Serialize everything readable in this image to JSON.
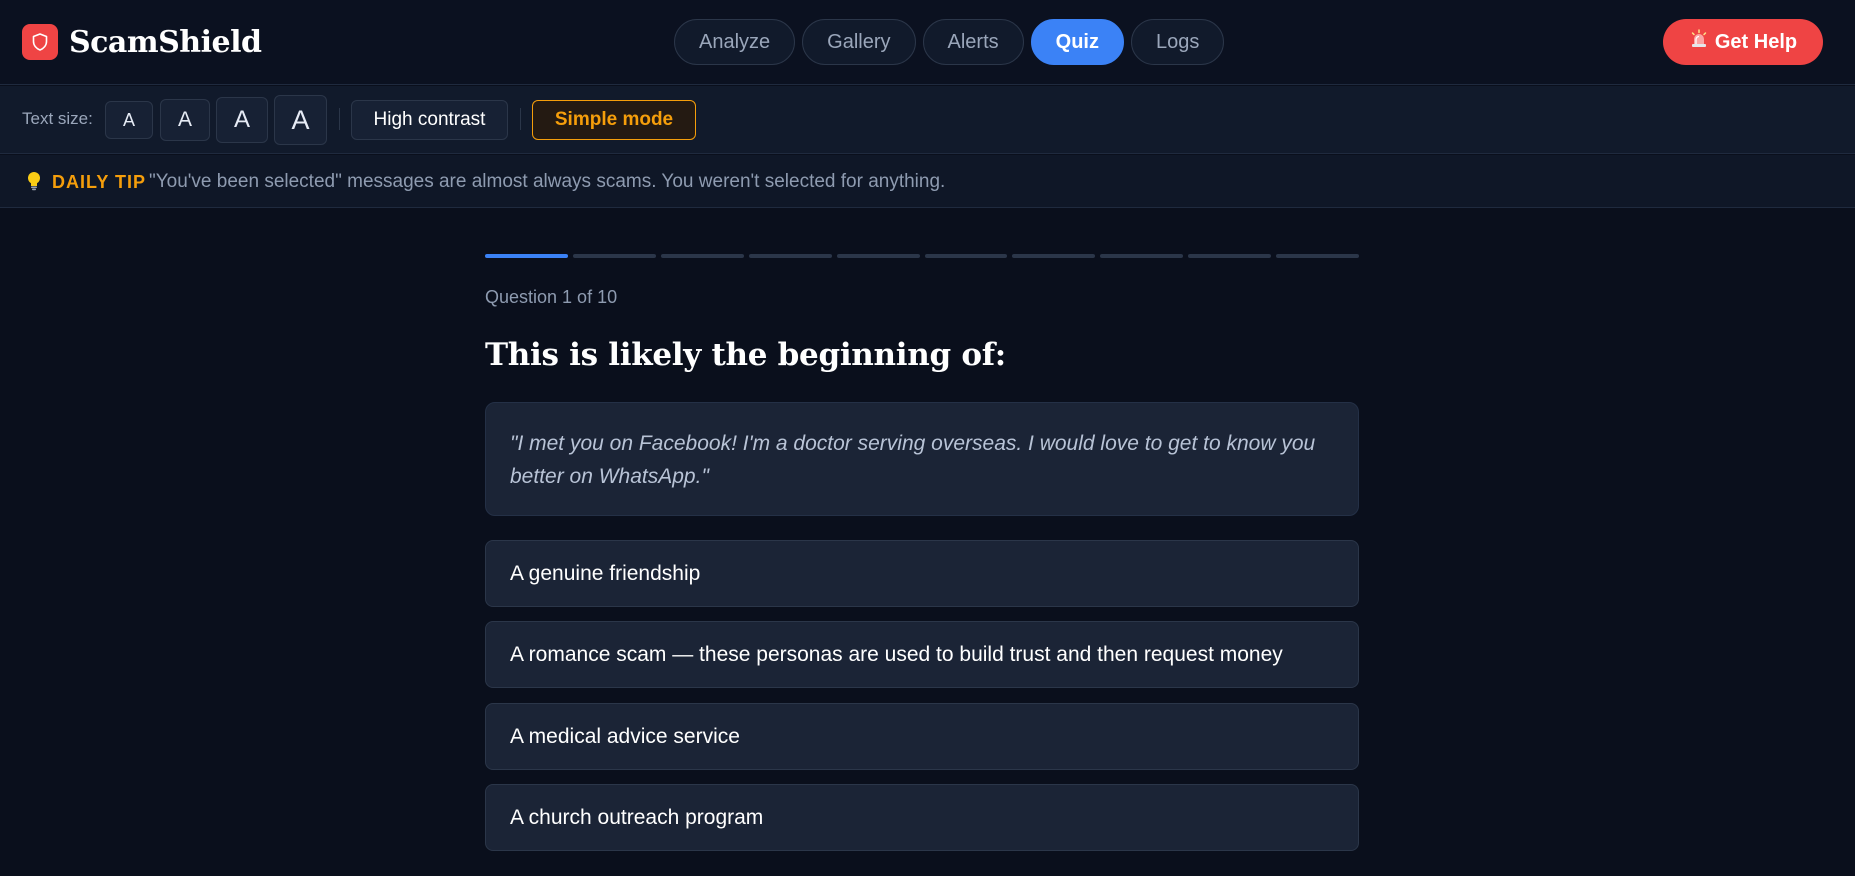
{
  "app": {
    "name": "ScamShield"
  },
  "nav": {
    "tabs": [
      {
        "label": "Analyze",
        "active": false
      },
      {
        "label": "Gallery",
        "active": false
      },
      {
        "label": "Alerts",
        "active": false
      },
      {
        "label": "Quiz",
        "active": true
      },
      {
        "label": "Logs",
        "active": false
      }
    ],
    "help_label": "Get Help",
    "help_icon": "siren-icon"
  },
  "toolbar": {
    "text_size_label": "Text size:",
    "size_buttons": [
      "A",
      "A",
      "A",
      "A"
    ],
    "high_contrast_label": "High contrast",
    "simple_mode_label": "Simple mode",
    "simple_mode_active": true
  },
  "tip": {
    "icon": "lightbulb-icon",
    "label": "DAILY TIP",
    "text": "\"You've been selected\" messages are almost always scams. You weren't selected for anything."
  },
  "quiz": {
    "current_question": 1,
    "total_questions": 10,
    "counter": "Question 1 of 10",
    "question": "This is likely the beginning of:",
    "quote": "\"I met you on Facebook! I'm a doctor serving overseas. I would love to get to know you better on WhatsApp.\"",
    "options": [
      "A genuine friendship",
      "A romance scam — these personas are used to build trust and then request money",
      "A medical advice service",
      "A church outreach program"
    ]
  },
  "colors": {
    "background": "#0a0f1c",
    "accent": "#3b82f6",
    "danger": "#ef4444",
    "warning": "#f59e0b"
  }
}
